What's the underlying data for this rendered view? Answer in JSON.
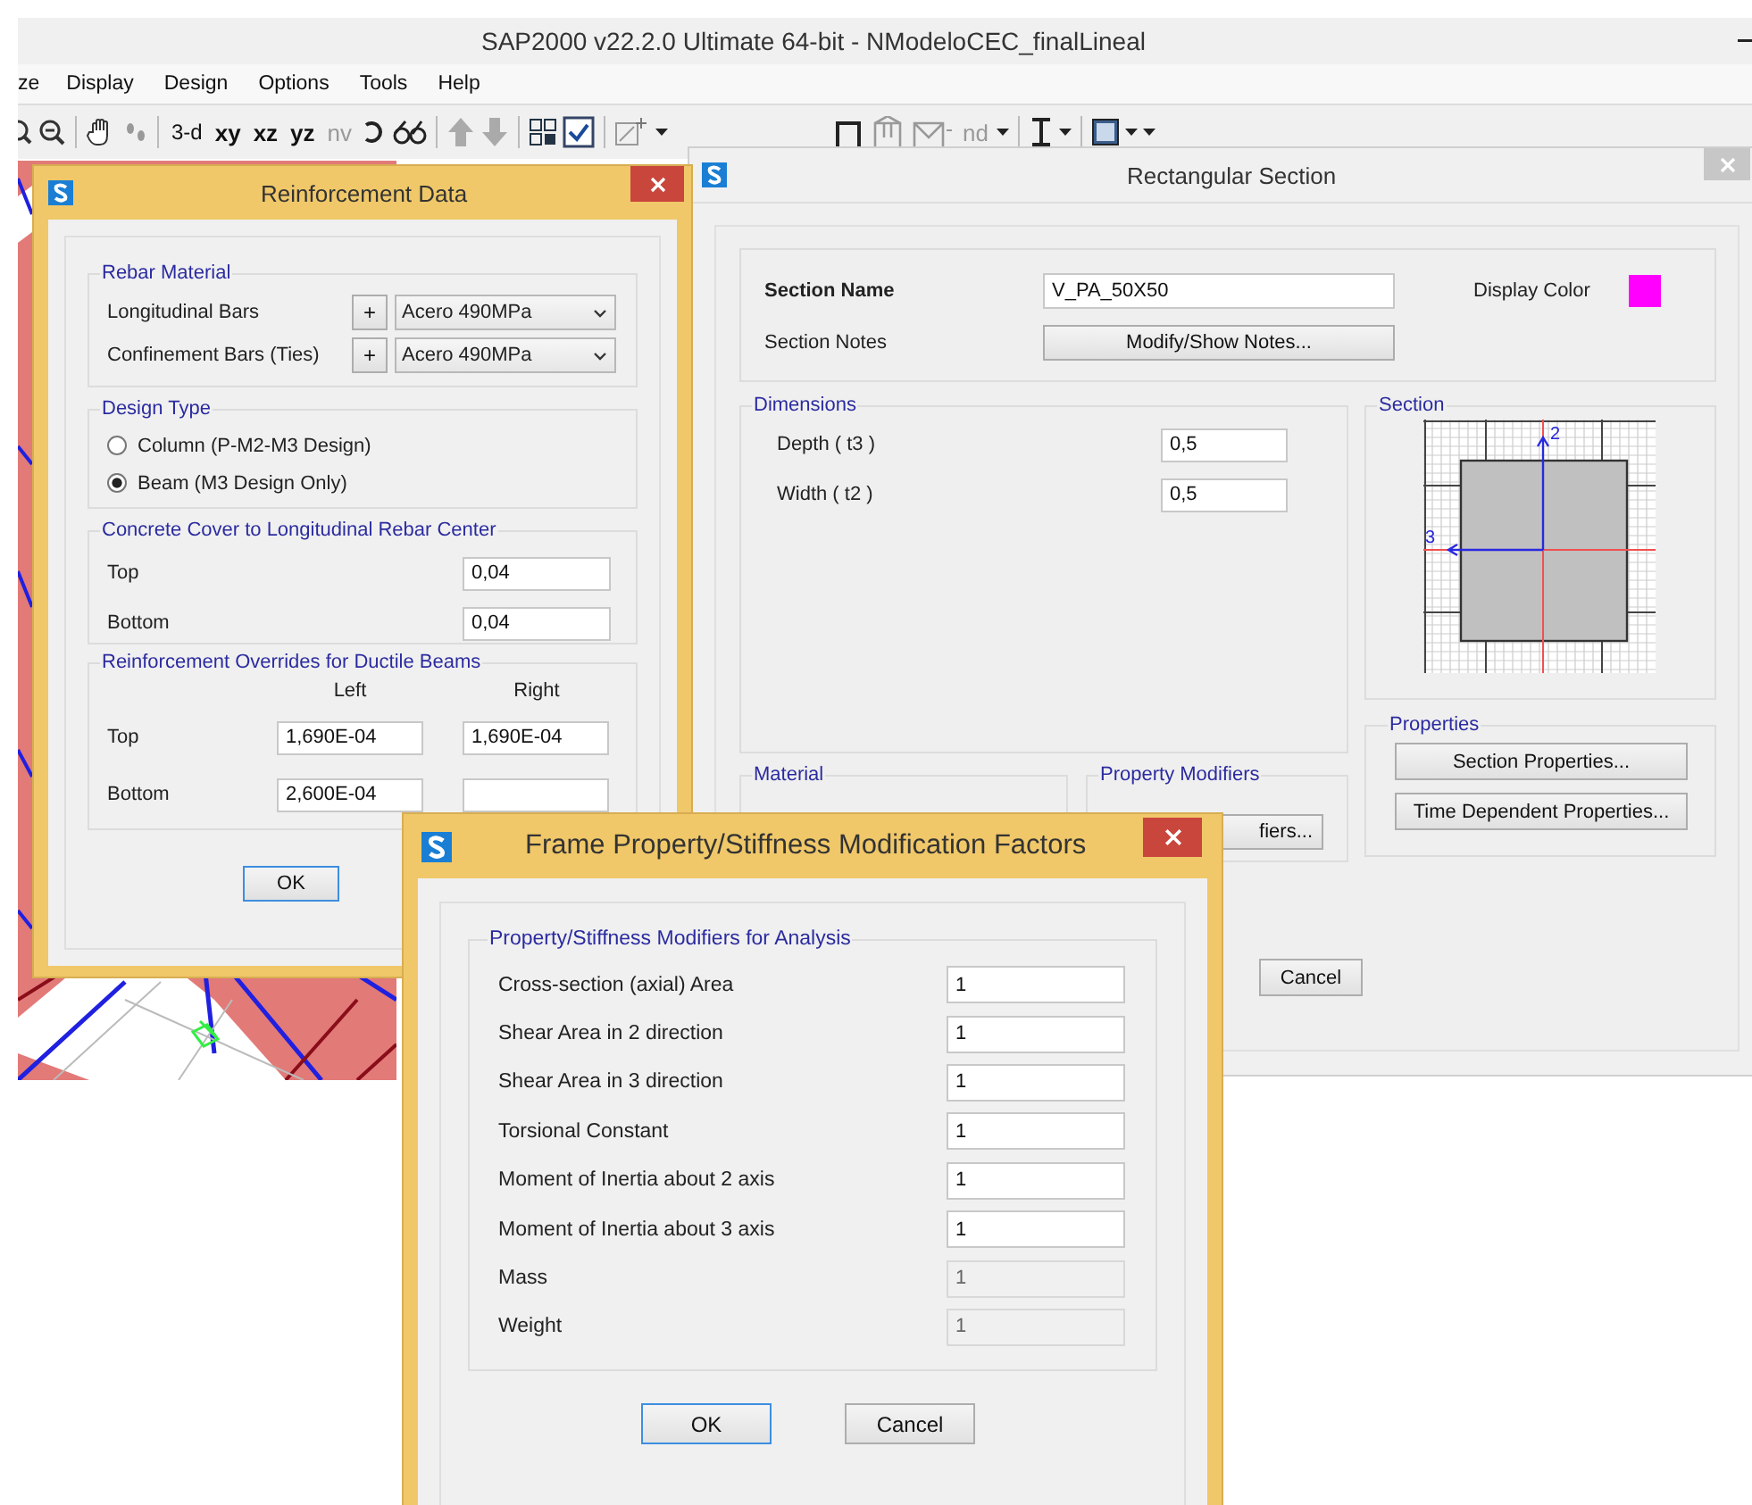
{
  "app": {
    "title": "SAP2000 v22.2.0 Ultimate 64-bit - NModeloCEC_finalLineal",
    "menu": [
      "ze",
      "Display",
      "Design",
      "Options",
      "Tools",
      "Help"
    ],
    "toolbar_labels": [
      "3-d",
      "xy",
      "xz",
      "yz",
      "nv"
    ],
    "toolbar2_labels": [
      "nd"
    ]
  },
  "reinforcement_data": {
    "title": "Reinforcement Data",
    "rebar_material": {
      "label": "Rebar Material",
      "rows": [
        {
          "label": "Longitudinal Bars",
          "button": "+",
          "value": "Acero 490MPa"
        },
        {
          "label": "Confinement Bars  (Ties)",
          "button": "+",
          "value": "Acero 490MPa"
        }
      ]
    },
    "design_type": {
      "label": "Design Type",
      "options": [
        {
          "label": "Column  (P-M2-M3 Design)",
          "selected": false
        },
        {
          "label": "Beam  (M3 Design Only)",
          "selected": true
        }
      ]
    },
    "concrete_cover": {
      "label": "Concrete Cover to Longitudinal Rebar Center",
      "rows": [
        {
          "label": "Top",
          "value": "0,04"
        },
        {
          "label": "Bottom",
          "value": "0,04"
        }
      ]
    },
    "overrides": {
      "label": "Reinforcement Overrides for Ductile Beams",
      "columns": [
        "Left",
        "Right"
      ],
      "rows": [
        {
          "label": "Top",
          "values": [
            "1,690E-04",
            "1,690E-04"
          ]
        },
        {
          "label": "Bottom",
          "values": [
            "2,600E-04"
          ]
        }
      ]
    },
    "buttons": [
      "OK"
    ]
  },
  "rectangular_section": {
    "title": "Rectangular Section",
    "section_name": {
      "label": "Section Name",
      "value": "V_PA_50X50"
    },
    "display_color": {
      "label": "Display Color",
      "color": "#ff00ff"
    },
    "section_notes": {
      "label": "Section Notes",
      "button": "Modify/Show Notes..."
    },
    "dimensions": {
      "label": "Dimensions",
      "rows": [
        {
          "label": "Depth  ( t3 )",
          "value": "0,5"
        },
        {
          "label": "Width  ( t2 )",
          "value": "0,5"
        }
      ]
    },
    "section": {
      "label": "Section",
      "axis_labels": [
        "2",
        "3"
      ]
    },
    "properties": {
      "label": "Properties",
      "buttons": [
        "Section Properties...",
        "Time Dependent Properties..."
      ]
    },
    "material": {
      "label": "Material"
    },
    "property_modifiers": {
      "label": "Property Modifiers",
      "button": "fiers..."
    },
    "buttons": [
      "Cancel"
    ]
  },
  "modification_factors": {
    "title": "Frame Property/Stiffness Modification Factors",
    "group_label": "Property/Stiffness Modifiers for Analysis",
    "rows": [
      {
        "label": "Cross-section (axial) Area",
        "value": "1",
        "disabled": false
      },
      {
        "label": "Shear Area in 2 direction",
        "value": "1",
        "disabled": false
      },
      {
        "label": "Shear Area in 3 direction",
        "value": "1",
        "disabled": false
      },
      {
        "label": "Torsional Constant",
        "value": "1",
        "disabled": false
      },
      {
        "label": "Moment of Inertia about 2 axis",
        "value": "1",
        "disabled": false
      },
      {
        "label": "Moment of Inertia about 3 axis",
        "value": "1",
        "disabled": false
      },
      {
        "label": "Mass",
        "value": "1",
        "disabled": true
      },
      {
        "label": "Weight",
        "value": "1",
        "disabled": true
      }
    ],
    "buttons": [
      {
        "label": "OK",
        "default": true
      },
      {
        "label": "Cancel",
        "default": false
      }
    ]
  }
}
